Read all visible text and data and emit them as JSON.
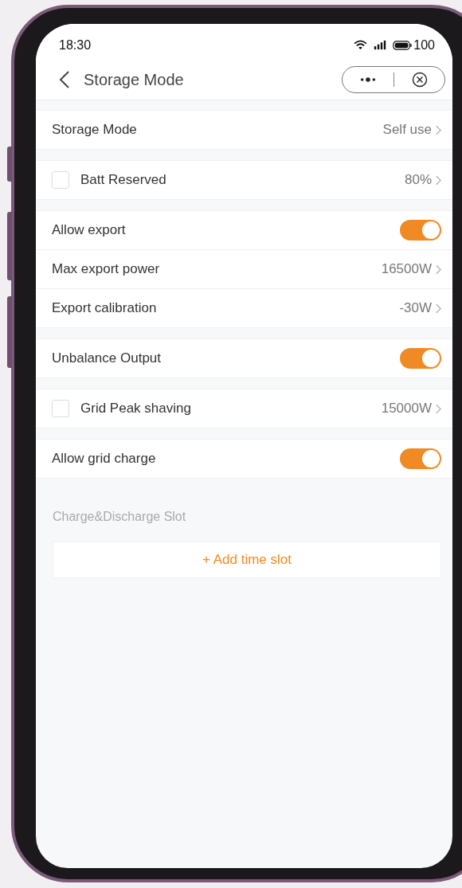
{
  "status_bar": {
    "time": "18:30",
    "battery": "100"
  },
  "header": {
    "title": "Storage Mode"
  },
  "groups": [
    {
      "rows": [
        {
          "kind": "value",
          "label": "Storage Mode",
          "value": "Self use"
        }
      ]
    },
    {
      "rows": [
        {
          "kind": "checkbox",
          "label": "Batt Reserved",
          "value": "80%",
          "checked": false
        }
      ]
    },
    {
      "rows": [
        {
          "kind": "toggle",
          "label": "Allow export",
          "on": true
        },
        {
          "kind": "value",
          "label": "Max export power",
          "value": "16500W"
        },
        {
          "kind": "value",
          "label": "Export calibration",
          "value": "-30W"
        }
      ]
    },
    {
      "rows": [
        {
          "kind": "toggle",
          "label": "Unbalance Output",
          "on": true
        }
      ]
    },
    {
      "rows": [
        {
          "kind": "checkbox",
          "label": "Grid Peak shaving",
          "value": "15000W",
          "checked": false
        }
      ]
    },
    {
      "rows": [
        {
          "kind": "toggle",
          "label": "Allow grid charge",
          "on": true
        }
      ]
    }
  ],
  "slots": {
    "title": "Charge&Discharge Slot",
    "add_button": "+ Add time slot"
  }
}
